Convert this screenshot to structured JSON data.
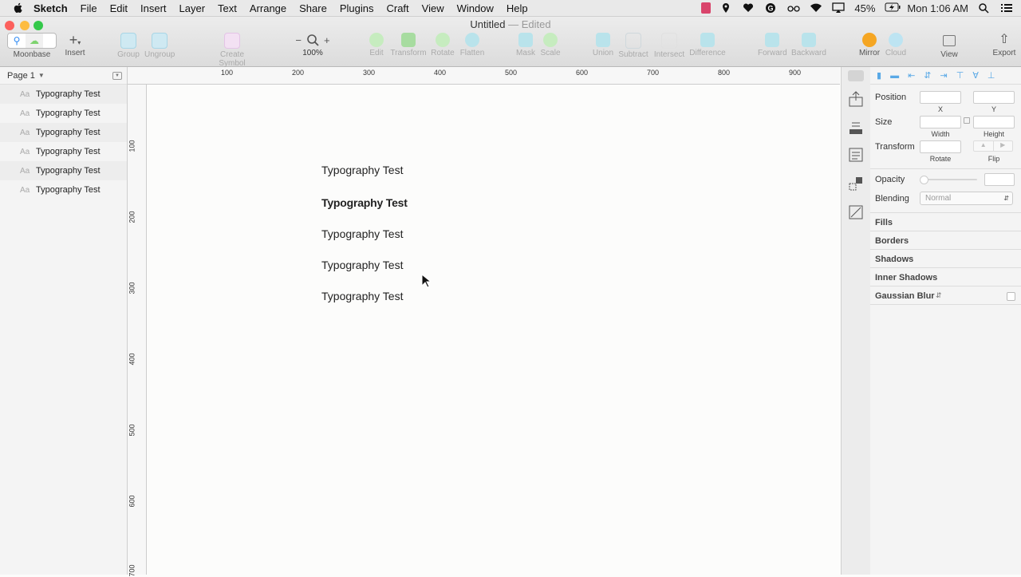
{
  "menubar": {
    "app": "Sketch",
    "items": [
      "File",
      "Edit",
      "Insert",
      "Layer",
      "Text",
      "Arrange",
      "Share",
      "Plugins",
      "Craft",
      "View",
      "Window",
      "Help"
    ],
    "battery": "45%",
    "clock": "Mon 1:06 AM"
  },
  "window": {
    "title": "Untitled",
    "status": "— Edited"
  },
  "toolbar": {
    "moonbase": "Moonbase",
    "insert": "Insert",
    "group": "Group",
    "ungroup": "Ungroup",
    "create_symbol": "Create Symbol",
    "zoom": "100%",
    "edit": "Edit",
    "transform": "Transform",
    "rotate": "Rotate",
    "flatten": "Flatten",
    "mask": "Mask",
    "scale": "Scale",
    "union": "Union",
    "subtract": "Subtract",
    "intersect": "Intersect",
    "difference": "Difference",
    "forward": "Forward",
    "backward": "Backward",
    "mirror": "Mirror",
    "cloud": "Cloud",
    "view": "View",
    "export": "Export"
  },
  "sidebar": {
    "page": "Page 1",
    "layers": [
      {
        "icon": "Aa",
        "name": "Typography Test"
      },
      {
        "icon": "Aa",
        "name": "Typography Test"
      },
      {
        "icon": "Aa",
        "name": "Typography Test"
      },
      {
        "icon": "Aa",
        "name": "Typography Test"
      },
      {
        "icon": "Aa",
        "name": "Typography Test"
      },
      {
        "icon": "Aa",
        "name": "Typography Test"
      }
    ]
  },
  "rulers": {
    "h": [
      "100",
      "200",
      "300",
      "400",
      "500",
      "600",
      "700",
      "800",
      "900"
    ],
    "v": [
      "100",
      "200",
      "300",
      "400",
      "500",
      "600",
      "700"
    ]
  },
  "canvas": {
    "texts": [
      "Typography Test",
      "Typography Test",
      "Typography Test",
      "Typography Test",
      "Typography Test"
    ]
  },
  "inspector": {
    "position": "Position",
    "x": "X",
    "y": "Y",
    "size": "Size",
    "width": "Width",
    "height": "Height",
    "transform": "Transform",
    "rotate": "Rotate",
    "flip": "Flip",
    "opacity": "Opacity",
    "blending": "Blending",
    "blending_value": "Normal",
    "fills": "Fills",
    "borders": "Borders",
    "shadows": "Shadows",
    "inner_shadows": "Inner Shadows",
    "gaussian_blur": "Gaussian Blur"
  },
  "colors": {
    "accent": "#2f8af3",
    "sketch_orange": "#f5a623",
    "tool_green": "#7ed36f",
    "tool_cyan": "#7fd0e8"
  }
}
